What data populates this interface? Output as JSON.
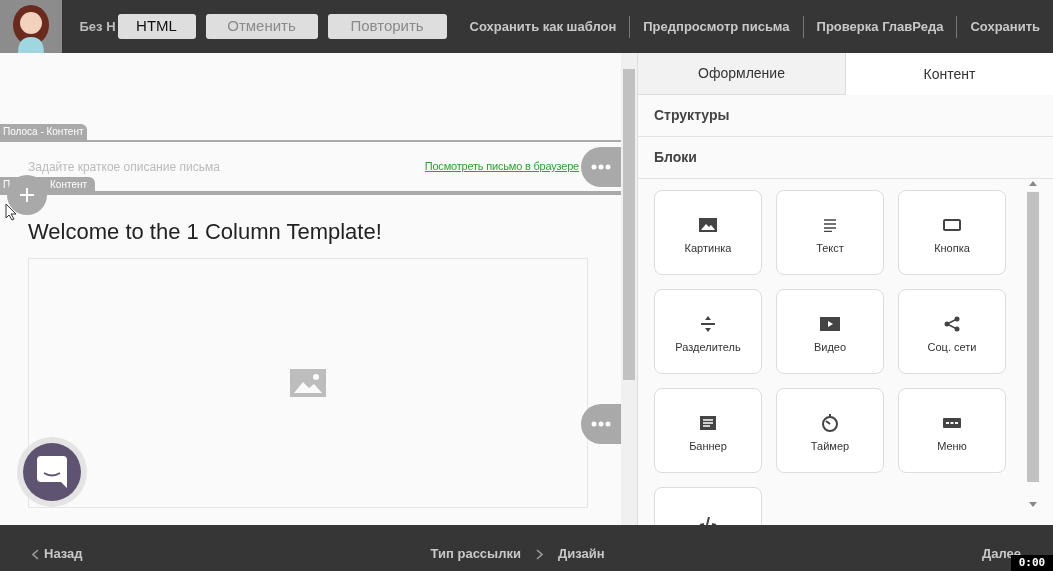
{
  "header": {
    "title_fragment": "Без Н",
    "buttons": [
      {
        "label": "HTML",
        "disabled": false
      },
      {
        "label": "Отменить",
        "disabled": true
      },
      {
        "label": "Повторить",
        "disabled": true
      }
    ],
    "links": [
      "Сохранить как шаблон",
      "Предпросмотр письма",
      "Проверка ГлавРеда",
      "Сохранить"
    ]
  },
  "editor": {
    "stripe_label": "Полоса - Контент",
    "preheader": {
      "placeholder": "Задайте краткое описание письма",
      "link": "Посмотреть письмо в браузере"
    },
    "stripe_label_2": {
      "start": "П",
      "end": "Контент"
    },
    "heading": "Welcome to the 1 Column Template!"
  },
  "panel": {
    "tabs": [
      {
        "label": "Оформление",
        "selected": false
      },
      {
        "label": "Контент",
        "selected": true
      }
    ],
    "sections": [
      "Структуры",
      "Блоки"
    ],
    "blocks": [
      {
        "kind": "image",
        "label": "Картинка"
      },
      {
        "kind": "text",
        "label": "Текст"
      },
      {
        "kind": "button",
        "label": "Кнопка"
      },
      {
        "kind": "divider",
        "label": "Разделитель"
      },
      {
        "kind": "video",
        "label": "Видео"
      },
      {
        "kind": "social",
        "label": "Соц. сети"
      },
      {
        "kind": "banner",
        "label": "Баннер"
      },
      {
        "kind": "timer",
        "label": "Таймер"
      },
      {
        "kind": "menu",
        "label": "Меню"
      },
      {
        "kind": "code"
      }
    ]
  },
  "footer": {
    "back": "Назад",
    "steps": [
      "Тип рассылки",
      "Дизайн"
    ],
    "next": "Далее"
  },
  "timer": "0:00"
}
